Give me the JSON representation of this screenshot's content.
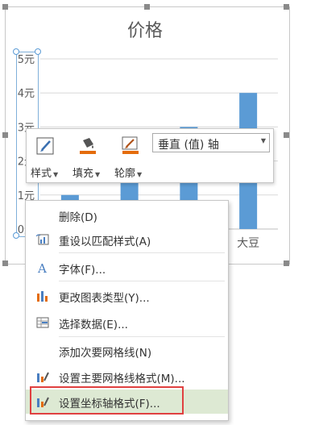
{
  "chart": {
    "title": "价格",
    "y_tick_labels": [
      "5元",
      "4元",
      "3元",
      "2元",
      "1元",
      "0元"
    ],
    "visible_category_label": "大豆",
    "bar_color": "#5b9bd5"
  },
  "chart_data": {
    "type": "bar",
    "title": "价格",
    "categories": [
      "",
      "",
      "",
      "大豆"
    ],
    "values": [
      1,
      2,
      3,
      4
    ],
    "ylim": [
      0,
      5
    ],
    "ytick_labels": [
      "0元",
      "1元",
      "2元",
      "3元",
      "4元",
      "5元"
    ],
    "grid": true
  },
  "mini_toolbar": {
    "style_label": "样式",
    "fill_label": "填充",
    "outline_label": "轮廓",
    "element_selector_value": "垂直 (值) 轴",
    "fill_color": "#e46c0a"
  },
  "context_menu": {
    "items": [
      {
        "label": "删除(D)",
        "icon": ""
      },
      {
        "label": "重设以匹配样式(A)",
        "icon": "reset-style-icon"
      },
      {
        "label": "字体(F)...",
        "icon": "font-icon"
      },
      {
        "label": "更改图表类型(Y)...",
        "icon": "chart-type-icon"
      },
      {
        "label": "选择数据(E)...",
        "icon": "select-data-icon"
      },
      {
        "label": "添加次要网格线(N)",
        "icon": ""
      },
      {
        "label": "设置主要网格线格式(M)...",
        "icon": "gridline-format-icon"
      },
      {
        "label": "设置坐标轴格式(F)...",
        "icon": "axis-format-icon"
      }
    ],
    "highlight_color": "#e04040"
  }
}
